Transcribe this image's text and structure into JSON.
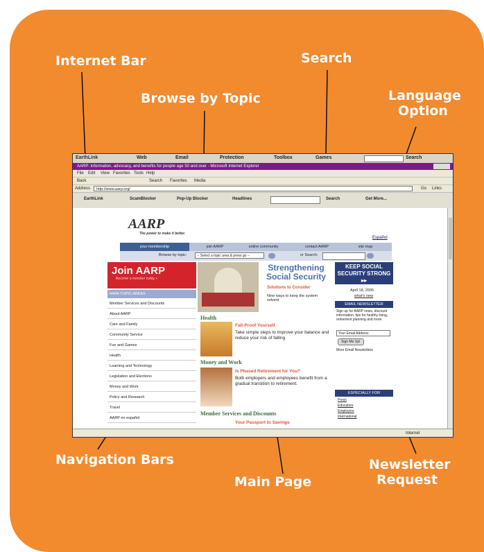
{
  "callouts": {
    "internet_bar": "Internet Bar",
    "search": "Search",
    "browse_by_topic": "Browse by Topic",
    "language_option": "Language Option",
    "navigation_bars": "Navigation Bars",
    "main_page": "Main Page",
    "newsletter_request": "Newsletter Request"
  },
  "browser": {
    "toolbar_items": [
      "EarthLink",
      "Web",
      "Email",
      "Protection",
      "Toolbox",
      "Games"
    ],
    "search_label": "Search",
    "window_title": "AARP: information, advocacy, and benefits for people age 50 and over - Microsoft Internet Explorer",
    "menu_items": [
      "File",
      "Edit",
      "View",
      "Favorites",
      "Tools",
      "Help"
    ],
    "std_buttons": [
      "Back",
      "Search",
      "Favorites",
      "Media"
    ],
    "address_label": "Address",
    "address_value": "http://www.aarp.org/",
    "go_label": "Go",
    "links_label": "Links",
    "tb2_items": [
      "EarthLink",
      "ScamBlocker",
      "Pop-Up Blocker",
      "Headlines",
      "Search",
      "Get More..."
    ],
    "status_text": "Internet"
  },
  "page": {
    "logo": "AARP",
    "tagline": "The power to make it better.",
    "language_link": "Español",
    "tabs": [
      "your membership",
      "join AARP",
      "online community",
      "contact AARP",
      "site map"
    ],
    "browse_label": "Browse by topic:",
    "browse_select": "-- Select a topic area & press go --",
    "search_label": "or Search:",
    "join_title": "Join AARP",
    "join_sub": "Become a member today »",
    "nav_header": "MAIN TOPIC AREAS",
    "nav_items": [
      "Member Services and Discounts",
      "About AARP",
      "Care and Family",
      "Community Service",
      "Fun and Games",
      "Health",
      "Learning and Technology",
      "Legislation and Elections",
      "Money and Work",
      "Policy and Research",
      "Travel",
      "AARP en español"
    ],
    "feature_title": "Strengthening Social Security",
    "feature_sub": "Solutions to Consider",
    "feature_text": "Nine ways to keep the system solvent",
    "right_banner": "KEEP SOCIAL SECURITY STRONG ▸▸",
    "date": "April 18, 2005",
    "whats_new": "what's new",
    "newsletter_header": "EMAIL NEWSLETTER",
    "newsletter_text": "Sign up for AARP news, discount information, tips for healthy living, retirement planning and more.",
    "email_placeholder": "Your Email Address",
    "signup_button": "Sign Me Up!",
    "more_newsletters": "More Email Newsletters",
    "especially_header": "ESPECIALLY FOR",
    "especially_items": [
      "Press",
      "Educators",
      "Employers",
      "International"
    ],
    "section_health": "Health",
    "health_title": "Fall-Proof Yourself",
    "health_text": "Take simple steps to improve your balance and reduce your risk of falling",
    "section_money": "Money and Work",
    "money_title": "Is Phased Retirement for You?",
    "money_text": "Both employers and employees benefit from a gradual transition to retirement.",
    "section_member": "Member Services and Discounts",
    "member_title": "Your Passport to Savings"
  }
}
